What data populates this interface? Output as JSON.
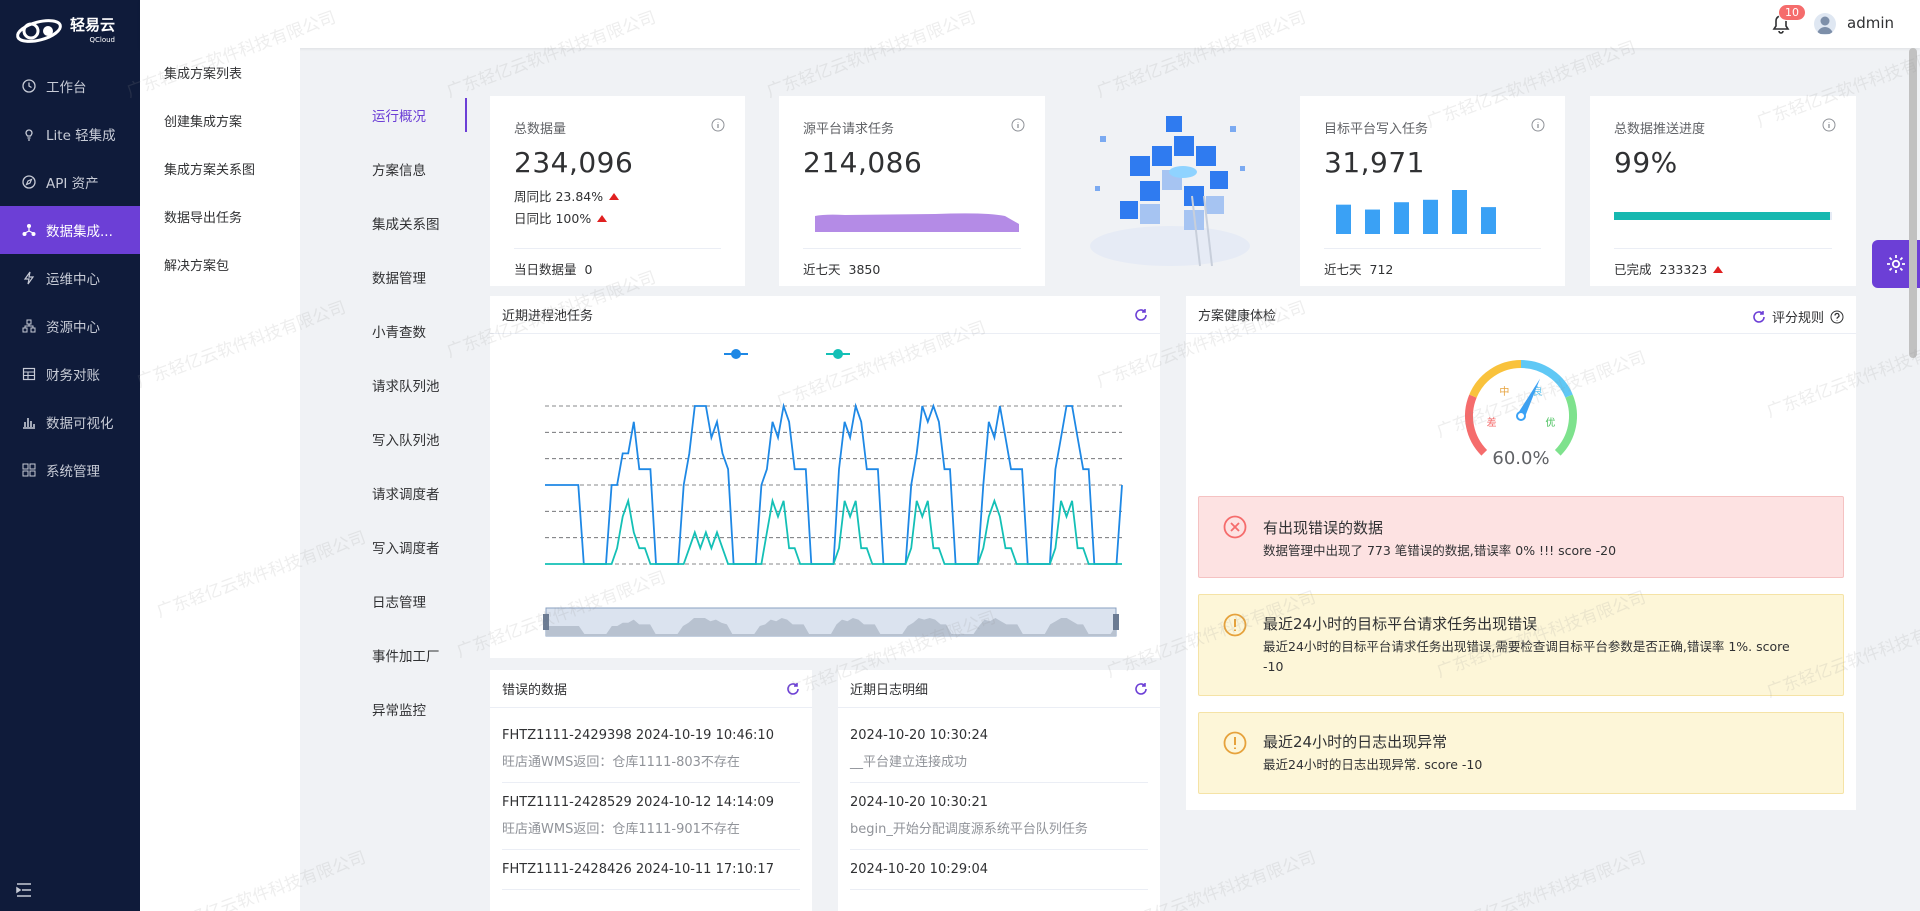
{
  "brand": {
    "name": "轻易云",
    "sub": "QCloud"
  },
  "nav": {
    "items": [
      {
        "label": "工作台",
        "icon": "clock-icon"
      },
      {
        "label": "Lite 轻集成",
        "icon": "bulb-icon"
      },
      {
        "label": "API 资产",
        "icon": "compass-icon"
      },
      {
        "label": "数据集成...",
        "icon": "share-nodes-icon",
        "active": true
      },
      {
        "label": "运维中心",
        "icon": "lightning-icon"
      },
      {
        "label": "资源中心",
        "icon": "cluster-icon"
      },
      {
        "label": "财务对账",
        "icon": "table-icon"
      },
      {
        "label": "数据可视化",
        "icon": "bar-chart-icon"
      },
      {
        "label": "系统管理",
        "icon": "grid-icon"
      }
    ]
  },
  "subnav": {
    "items": [
      "集成方案列表",
      "创建集成方案",
      "集成方案关系图",
      "数据导出任务",
      "解决方案包"
    ]
  },
  "header": {
    "badge": "10",
    "username": "admin"
  },
  "tabs": [
    "运行概况",
    "方案信息",
    "集成关系图",
    "数据管理",
    "小青查数",
    "请求队列池",
    "写入队列池",
    "请求调度者",
    "写入调度者",
    "日志管理",
    "事件加工厂",
    "异常监控"
  ],
  "stats": {
    "total": {
      "title": "总数据量",
      "value": "234,096",
      "wow": "周同比 23.84%",
      "dod": "日同比 100%",
      "foot_label": "当日数据量",
      "foot_value": "0"
    },
    "source": {
      "title": "源平台请求任务",
      "value": "214,086",
      "foot_label": "近七天",
      "foot_value": "3850"
    },
    "target": {
      "title": "目标平台写入任务",
      "value": "31,971",
      "foot_label": "近七天",
      "foot_value": "712",
      "bars": [
        2.4,
        2.0,
        2.6,
        2.8,
        3.6,
        2.2
      ]
    },
    "progress": {
      "title": "总数据推送进度",
      "value": "99%",
      "percent": 99,
      "foot_label": "已完成",
      "foot_value": "233323"
    }
  },
  "pool_chart": {
    "title": "近期进程池任务",
    "colors": [
      "#1e88e5",
      "#14c0b6"
    ],
    "series": [
      {
        "values": [
          5,
          5,
          5,
          5,
          5,
          5,
          5,
          0,
          0,
          0,
          0,
          0,
          5,
          5,
          7,
          7,
          9,
          6,
          6,
          6,
          0,
          0,
          0,
          0,
          0,
          5,
          7,
          10,
          10,
          10,
          8,
          9,
          7,
          6,
          0,
          0,
          0,
          0,
          0,
          5,
          6,
          9,
          8,
          10,
          9,
          6,
          6,
          6,
          0,
          0,
          0,
          0,
          0,
          6,
          9,
          8,
          10,
          9,
          6,
          6,
          6,
          0,
          0,
          0,
          0,
          0,
          5,
          7,
          10,
          9,
          10,
          9,
          6,
          6,
          0,
          0,
          0,
          0,
          0,
          5,
          9,
          8,
          10,
          8,
          6,
          6,
          6,
          0,
          0,
          0,
          0,
          0,
          6,
          8,
          10,
          10,
          8,
          6,
          6,
          0,
          0,
          0,
          0,
          0,
          5
        ]
      },
      {
        "values": [
          0,
          0,
          0,
          0,
          0,
          0,
          0,
          0,
          0,
          0,
          0,
          0,
          0,
          1,
          3,
          4,
          2,
          1,
          1,
          0,
          0,
          0,
          0,
          0,
          0,
          0,
          1,
          2,
          1,
          2,
          1,
          2,
          1,
          0,
          0,
          0,
          0,
          0,
          0,
          0,
          2,
          4,
          3,
          4,
          1,
          1,
          0,
          0,
          0,
          0,
          0,
          0,
          0,
          1,
          4,
          3,
          4,
          1,
          1,
          0,
          0,
          0,
          0,
          0,
          0,
          0,
          1,
          4,
          3,
          4,
          1,
          1,
          0,
          0,
          0,
          0,
          0,
          0,
          0,
          1,
          3,
          4,
          3,
          1,
          1,
          0,
          0,
          0,
          0,
          0,
          0,
          0,
          1,
          4,
          3,
          4,
          1,
          1,
          0,
          0,
          0,
          0,
          0,
          0,
          0
        ]
      }
    ],
    "ylim": [
      0,
      10
    ]
  },
  "health": {
    "title": "方案健康体检",
    "rules_label": "评分规则",
    "score": "60.0%",
    "score_value": 60,
    "gauge_labels": [
      "差",
      "中",
      "良",
      "优"
    ],
    "alerts": [
      {
        "type": "error",
        "title": "有出现错误的数据",
        "text": "数据管理中出现了 773 笔错误的数据,错误率 0% !!! score -20"
      },
      {
        "type": "warning",
        "title": "最近24小时的目标平台请求任务出现错误",
        "text": "最近24小时的目标平台请求任务出现错误,需要检查调目标平台参数是否正确,错误率 1%. score -10"
      },
      {
        "type": "warning",
        "title": "最近24小时的日志出现异常",
        "text": "最近24小时的日志出现异常. score -10"
      }
    ]
  },
  "errors": {
    "title": "错误的数据",
    "items": [
      {
        "main": "FHTZ1111-2429398 2024-10-19 10:46:10",
        "sub": "旺店通WMS返回：仓库1111-803不存在"
      },
      {
        "main": "FHTZ1111-2428529 2024-10-12 14:14:09",
        "sub": "旺店通WMS返回：仓库1111-901不存在"
      },
      {
        "main": "FHTZ1111-2428426 2024-10-11 17:10:17",
        "sub": ""
      }
    ]
  },
  "logs": {
    "title": "近期日志明细",
    "items": [
      {
        "main": "2024-10-20 10:30:24",
        "sub": "__平台建立连接成功"
      },
      {
        "main": "2024-10-20 10:30:21",
        "sub": "begin_开始分配调度源系统平台队列任务"
      },
      {
        "main": "2024-10-20 10:29:04",
        "sub": ""
      }
    ]
  },
  "watermark": "广东轻亿云软件科技有限公司"
}
